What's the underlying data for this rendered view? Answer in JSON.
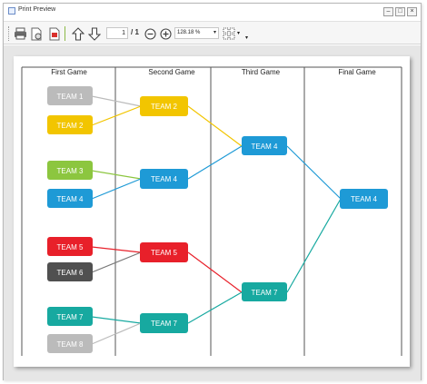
{
  "window": {
    "title": "Print Preview",
    "minimize_label": "–",
    "maximize_label": "□",
    "close_label": "×"
  },
  "toolbar": {
    "page_value": "1",
    "page_total": "/ 1",
    "zoom_value": "128.18 %"
  },
  "bracket": {
    "columns": [
      "First Game",
      "Second Game",
      "Third Game",
      "Final Game"
    ],
    "colors": {
      "gray": "#bbbbbb",
      "yellow": "#f2c500",
      "green": "#8cc63f",
      "blue": "#1e9ad6",
      "red": "#e8202a",
      "dark": "#505050",
      "teal": "#17a9a0"
    },
    "round1": [
      "TEAM 1",
      "TEAM 2",
      "TEAM 3",
      "TEAM 4",
      "TEAM 5",
      "TEAM 6",
      "TEAM 7",
      "TEAM 8"
    ],
    "round2": [
      "TEAM 2",
      "TEAM 4",
      "TEAM 5",
      "TEAM 7"
    ],
    "round3": [
      "TEAM 4",
      "TEAM 7"
    ],
    "final": [
      "TEAM 4"
    ]
  }
}
